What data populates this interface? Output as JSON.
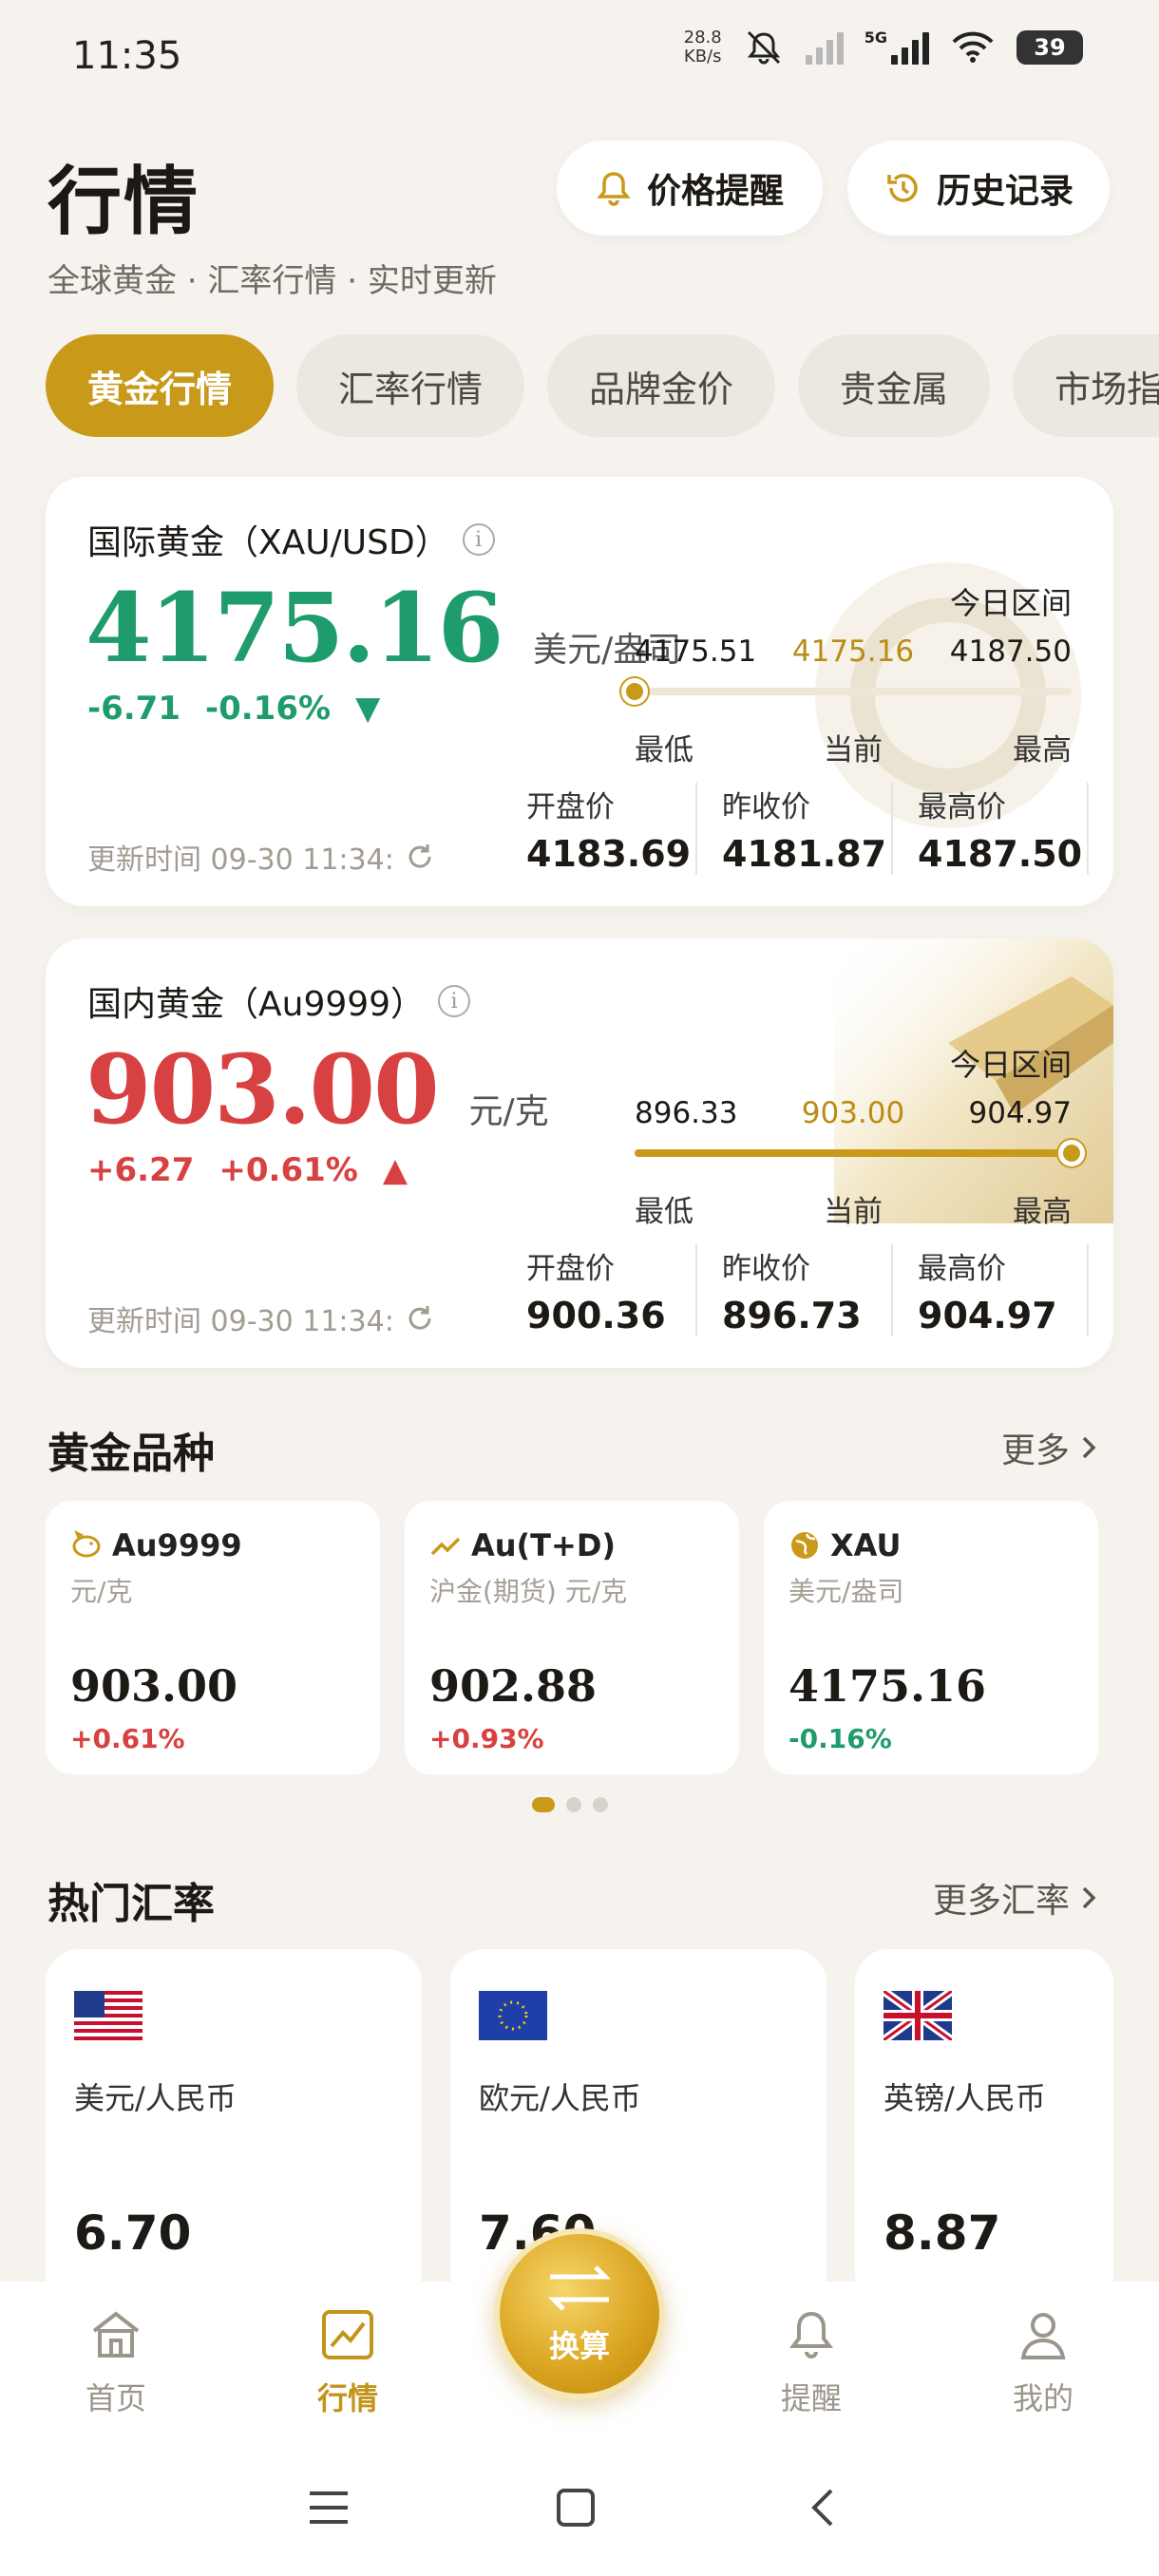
{
  "status_bar": {
    "time": "11:35",
    "net_speed_value": "28.8",
    "net_speed_unit": "KB/s",
    "network": "5G",
    "battery": "39"
  },
  "header": {
    "title": "行情",
    "subtitle": "全球黄金 · 汇率行情 · 实时更新",
    "price_alert_label": "价格提醒",
    "history_label": "历史记录"
  },
  "tabs": [
    {
      "label": "黄金行情",
      "active": true
    },
    {
      "label": "汇率行情",
      "active": false
    },
    {
      "label": "品牌金价",
      "active": false
    },
    {
      "label": "贵金属",
      "active": false
    },
    {
      "label": "市场指",
      "active": false
    }
  ],
  "international": {
    "title": "国际黄金（XAU/USD）",
    "price": "4175.16",
    "unit": "美元/盎司",
    "change": "-6.71",
    "change_pct": "-0.16%",
    "trend_glyph": "▼",
    "range_label": "今日区间",
    "low": "4175.51",
    "current": "4175.16",
    "high": "4187.50",
    "position_fraction": 0.0,
    "low_caption": "最低",
    "current_caption": "当前",
    "high_caption": "最高",
    "updated": "更新时间 09-30 11:34:",
    "open_label": "开盘价",
    "open": "4183.69",
    "prev_close_label": "昨收价",
    "prev_close": "4181.87",
    "high_label": "最高价",
    "high_value": "4187.50"
  },
  "domestic": {
    "title": "国内黄金（Au9999）",
    "price": "903.00",
    "unit": "元/克",
    "change": "+6.27",
    "change_pct": "+0.61%",
    "trend_glyph": "▲",
    "range_label": "今日区间",
    "low": "896.33",
    "current": "903.00",
    "high": "904.97",
    "position_fraction": 1.0,
    "low_caption": "最低",
    "current_caption": "当前",
    "high_caption": "最高",
    "updated": "更新时间 09-30 11:34:",
    "open_label": "开盘价",
    "open": "900.36",
    "prev_close_label": "昨收价",
    "prev_close": "896.73",
    "high_label": "最高价",
    "high_value": "904.97"
  },
  "varieties": {
    "title": "黄金品种",
    "more": "更多",
    "items": [
      {
        "name": "Au9999",
        "sub": "元/克",
        "price": "903.00",
        "pct": "+0.61%",
        "icon": "piggy-bank-icon"
      },
      {
        "name": "Au(T+D)",
        "sub": "沪金(期货) 元/克",
        "price": "902.88",
        "pct": "+0.93%",
        "icon": "trend-line-icon"
      },
      {
        "name": "XAU",
        "sub": "美元/盎司",
        "price": "4175.16",
        "pct": "-0.16%",
        "icon": "globe-icon"
      }
    ],
    "page_count": 3,
    "active_page": 0
  },
  "fx": {
    "title": "热门汇率",
    "more": "更多汇率",
    "items": [
      {
        "pair": "美元/人民币",
        "rate": "6.70",
        "flag": "us-flag-icon"
      },
      {
        "pair": "欧元/人民币",
        "rate": "7.60",
        "flag": "eu-flag-icon"
      },
      {
        "pair": "英镑/人民币",
        "rate": "8.87",
        "flag": "uk-flag-icon"
      }
    ]
  },
  "nav": {
    "home": "首页",
    "market": "行情",
    "convert": "换算",
    "alerts": "提醒",
    "mine": "我的",
    "active": "market"
  },
  "colors": {
    "accent": "#c9991a",
    "up": "#d84141",
    "down": "#1f9c6b",
    "background": "#f6f3ee"
  }
}
